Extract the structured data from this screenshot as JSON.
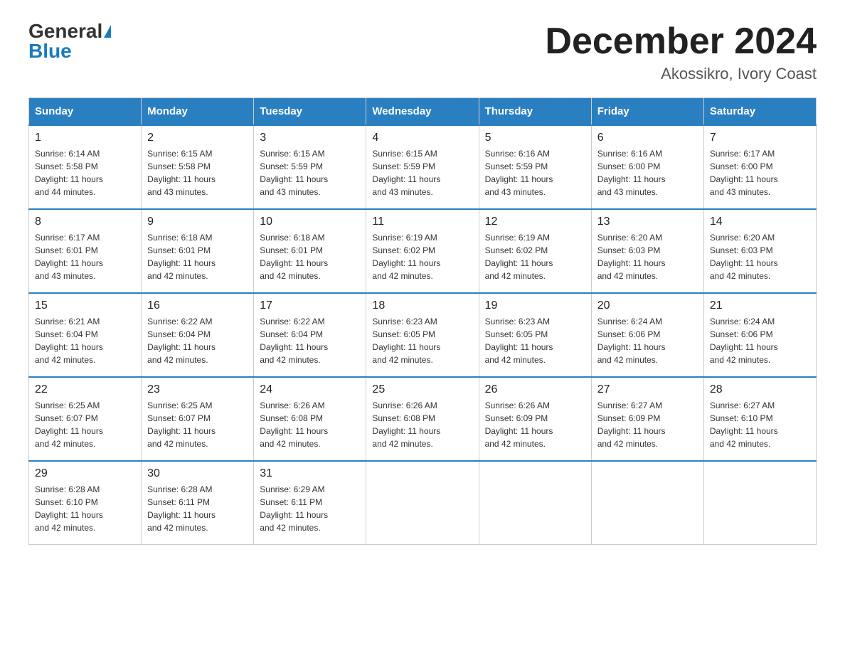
{
  "header": {
    "logo_general": "General",
    "logo_blue": "Blue",
    "month_title": "December 2024",
    "location": "Akossikro, Ivory Coast"
  },
  "days_of_week": [
    "Sunday",
    "Monday",
    "Tuesday",
    "Wednesday",
    "Thursday",
    "Friday",
    "Saturday"
  ],
  "weeks": [
    [
      {
        "day": "1",
        "sunrise": "6:14 AM",
        "sunset": "5:58 PM",
        "daylight": "11 hours and 44 minutes."
      },
      {
        "day": "2",
        "sunrise": "6:15 AM",
        "sunset": "5:58 PM",
        "daylight": "11 hours and 43 minutes."
      },
      {
        "day": "3",
        "sunrise": "6:15 AM",
        "sunset": "5:59 PM",
        "daylight": "11 hours and 43 minutes."
      },
      {
        "day": "4",
        "sunrise": "6:15 AM",
        "sunset": "5:59 PM",
        "daylight": "11 hours and 43 minutes."
      },
      {
        "day": "5",
        "sunrise": "6:16 AM",
        "sunset": "5:59 PM",
        "daylight": "11 hours and 43 minutes."
      },
      {
        "day": "6",
        "sunrise": "6:16 AM",
        "sunset": "6:00 PM",
        "daylight": "11 hours and 43 minutes."
      },
      {
        "day": "7",
        "sunrise": "6:17 AM",
        "sunset": "6:00 PM",
        "daylight": "11 hours and 43 minutes."
      }
    ],
    [
      {
        "day": "8",
        "sunrise": "6:17 AM",
        "sunset": "6:01 PM",
        "daylight": "11 hours and 43 minutes."
      },
      {
        "day": "9",
        "sunrise": "6:18 AM",
        "sunset": "6:01 PM",
        "daylight": "11 hours and 42 minutes."
      },
      {
        "day": "10",
        "sunrise": "6:18 AM",
        "sunset": "6:01 PM",
        "daylight": "11 hours and 42 minutes."
      },
      {
        "day": "11",
        "sunrise": "6:19 AM",
        "sunset": "6:02 PM",
        "daylight": "11 hours and 42 minutes."
      },
      {
        "day": "12",
        "sunrise": "6:19 AM",
        "sunset": "6:02 PM",
        "daylight": "11 hours and 42 minutes."
      },
      {
        "day": "13",
        "sunrise": "6:20 AM",
        "sunset": "6:03 PM",
        "daylight": "11 hours and 42 minutes."
      },
      {
        "day": "14",
        "sunrise": "6:20 AM",
        "sunset": "6:03 PM",
        "daylight": "11 hours and 42 minutes."
      }
    ],
    [
      {
        "day": "15",
        "sunrise": "6:21 AM",
        "sunset": "6:04 PM",
        "daylight": "11 hours and 42 minutes."
      },
      {
        "day": "16",
        "sunrise": "6:22 AM",
        "sunset": "6:04 PM",
        "daylight": "11 hours and 42 minutes."
      },
      {
        "day": "17",
        "sunrise": "6:22 AM",
        "sunset": "6:04 PM",
        "daylight": "11 hours and 42 minutes."
      },
      {
        "day": "18",
        "sunrise": "6:23 AM",
        "sunset": "6:05 PM",
        "daylight": "11 hours and 42 minutes."
      },
      {
        "day": "19",
        "sunrise": "6:23 AM",
        "sunset": "6:05 PM",
        "daylight": "11 hours and 42 minutes."
      },
      {
        "day": "20",
        "sunrise": "6:24 AM",
        "sunset": "6:06 PM",
        "daylight": "11 hours and 42 minutes."
      },
      {
        "day": "21",
        "sunrise": "6:24 AM",
        "sunset": "6:06 PM",
        "daylight": "11 hours and 42 minutes."
      }
    ],
    [
      {
        "day": "22",
        "sunrise": "6:25 AM",
        "sunset": "6:07 PM",
        "daylight": "11 hours and 42 minutes."
      },
      {
        "day": "23",
        "sunrise": "6:25 AM",
        "sunset": "6:07 PM",
        "daylight": "11 hours and 42 minutes."
      },
      {
        "day": "24",
        "sunrise": "6:26 AM",
        "sunset": "6:08 PM",
        "daylight": "11 hours and 42 minutes."
      },
      {
        "day": "25",
        "sunrise": "6:26 AM",
        "sunset": "6:08 PM",
        "daylight": "11 hours and 42 minutes."
      },
      {
        "day": "26",
        "sunrise": "6:26 AM",
        "sunset": "6:09 PM",
        "daylight": "11 hours and 42 minutes."
      },
      {
        "day": "27",
        "sunrise": "6:27 AM",
        "sunset": "6:09 PM",
        "daylight": "11 hours and 42 minutes."
      },
      {
        "day": "28",
        "sunrise": "6:27 AM",
        "sunset": "6:10 PM",
        "daylight": "11 hours and 42 minutes."
      }
    ],
    [
      {
        "day": "29",
        "sunrise": "6:28 AM",
        "sunset": "6:10 PM",
        "daylight": "11 hours and 42 minutes."
      },
      {
        "day": "30",
        "sunrise": "6:28 AM",
        "sunset": "6:11 PM",
        "daylight": "11 hours and 42 minutes."
      },
      {
        "day": "31",
        "sunrise": "6:29 AM",
        "sunset": "6:11 PM",
        "daylight": "11 hours and 42 minutes."
      },
      null,
      null,
      null,
      null
    ]
  ],
  "labels": {
    "sunrise": "Sunrise:",
    "sunset": "Sunset:",
    "daylight": "Daylight:"
  }
}
